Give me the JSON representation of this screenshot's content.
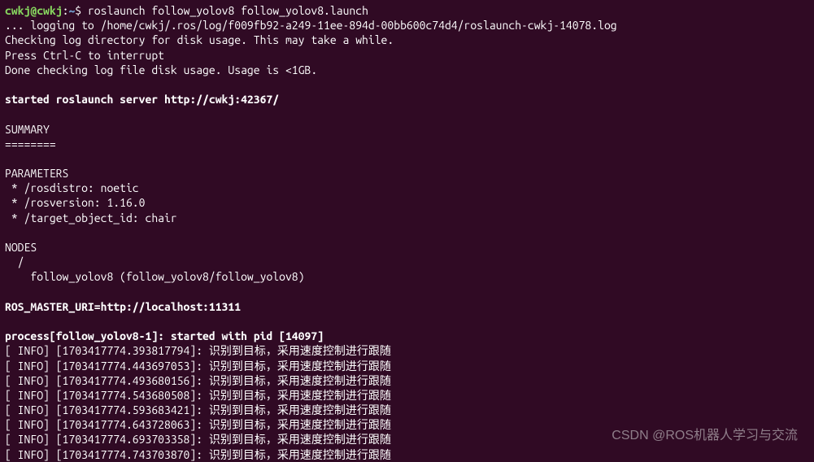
{
  "prompt": {
    "user": "cwkj",
    "host": "cwkj",
    "path": "~",
    "symbol": "$"
  },
  "command": "roslaunch follow_yolov8 follow_yolov8.launch",
  "output": {
    "log_line": "... logging to /home/cwkj/.ros/log/f009fb92-a249-11ee-894d-00bb600c74d4/roslaunch-cwkj-14078.log",
    "checking": "Checking log directory for disk usage. This may take a while.",
    "interrupt": "Press Ctrl-C to interrupt",
    "done_check": "Done checking log file disk usage. Usage is <1GB.",
    "server": "started roslaunch server http://cwkj:42367/",
    "summary": "SUMMARY",
    "divider": "========",
    "parameters_header": "PARAMETERS",
    "param1": " * /rosdistro: noetic",
    "param2": " * /rosversion: 1.16.0",
    "param3": " * /target_object_id: chair",
    "nodes_header": "NODES",
    "nodes_slash": "  /",
    "node_line": "    follow_yolov8 (follow_yolov8/follow_yolov8)",
    "ros_master": "ROS_MASTER_URI=http://localhost:11311",
    "process": "process[follow_yolov8-1]: started with pid [14097]",
    "info_msg": "识别到目标，采用速度控制进行跟随",
    "info_lines": [
      "[ INFO] [1703417774.393817794]: ",
      "[ INFO] [1703417774.443697053]: ",
      "[ INFO] [1703417774.493680156]: ",
      "[ INFO] [1703417774.543680508]: ",
      "[ INFO] [1703417774.593683421]: ",
      "[ INFO] [1703417774.643728063]: ",
      "[ INFO] [1703417774.693703358]: ",
      "[ INFO] [1703417774.743703870]: "
    ]
  },
  "watermark": "CSDN @ROS机器人学习与交流"
}
